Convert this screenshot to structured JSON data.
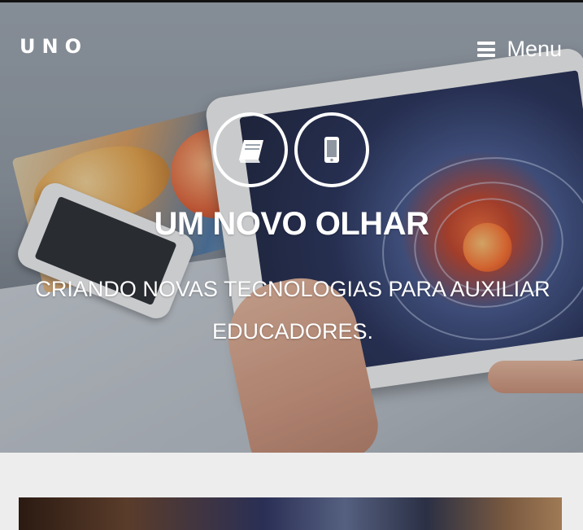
{
  "header": {
    "brand": "UNO",
    "menu_label": "Menu"
  },
  "hero": {
    "icons": [
      "book-icon",
      "mobile-icon"
    ],
    "headline": "UM NOVO OLHAR",
    "subtitle": "CRIANDO NOVAS TECNOLOGIAS PARA AUXILIAR EDUCADORES."
  },
  "colors": {
    "text": "#ffffff",
    "page_bg": "#ededed",
    "top_line": "#111111"
  }
}
